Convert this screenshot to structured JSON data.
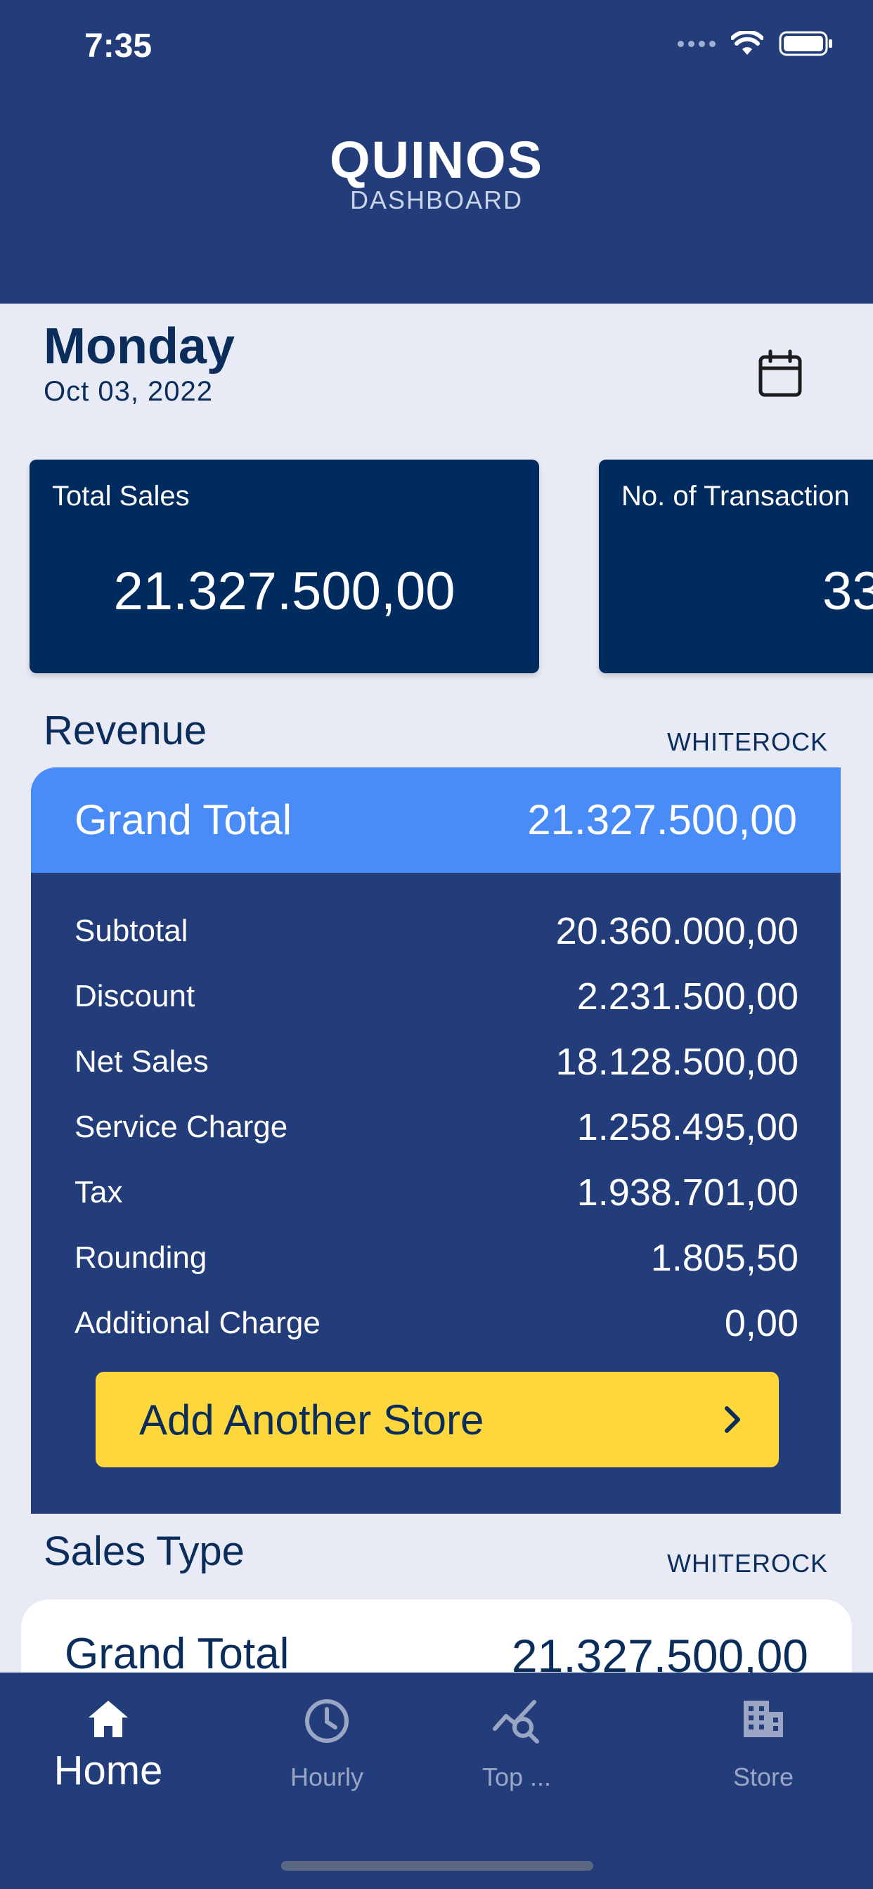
{
  "status_bar": {
    "time": "7:35",
    "icons": [
      "cellular-dots-icon",
      "wifi-icon",
      "battery-icon"
    ]
  },
  "header": {
    "brand": "QUINOS",
    "subtitle": "DASHBOARD"
  },
  "date": {
    "day": "Monday",
    "date": "Oct 03, 2022",
    "calendar_icon": "calendar-icon"
  },
  "kpis": [
    {
      "label": "Total Sales",
      "value": "21.327.500,00"
    },
    {
      "label": "No. of Transaction",
      "value": "33"
    }
  ],
  "revenue": {
    "title": "Revenue",
    "store": "WHITEROCK",
    "grand_total_label": "Grand Total",
    "grand_total_value": "21.327.500,00",
    "rows": [
      {
        "label": "Subtotal",
        "value": "20.360.000,00"
      },
      {
        "label": "Discount",
        "value": "2.231.500,00"
      },
      {
        "label": "Net Sales",
        "value": "18.128.500,00"
      },
      {
        "label": "Service Charge",
        "value": "1.258.495,00"
      },
      {
        "label": "Tax",
        "value": "1.938.701,00"
      },
      {
        "label": "Rounding",
        "value": "1.805,50"
      },
      {
        "label": "Additional Charge",
        "value": "0,00"
      }
    ],
    "add_store_label": "Add Another Store"
  },
  "sales_type": {
    "title": "Sales Type",
    "store": "WHITEROCK",
    "grand_total_label": "Grand Total",
    "grand_total_value": "21.327.500,00"
  },
  "nav": {
    "items": [
      {
        "label": "Home",
        "icon": "home-icon",
        "active": true
      },
      {
        "label": "Hourly",
        "icon": "clock-icon",
        "active": false
      },
      {
        "label": "Top ...",
        "icon": "chart-search-icon",
        "active": false
      },
      {
        "label": "Store",
        "icon": "building-icon",
        "active": false
      }
    ]
  },
  "colors": {
    "header_bg": "#233d7a",
    "page_bg": "#e8ebf5",
    "kpi_bg": "#002b5e",
    "grand_total_bg": "#4a8cf7",
    "button_bg": "#fed73c"
  }
}
